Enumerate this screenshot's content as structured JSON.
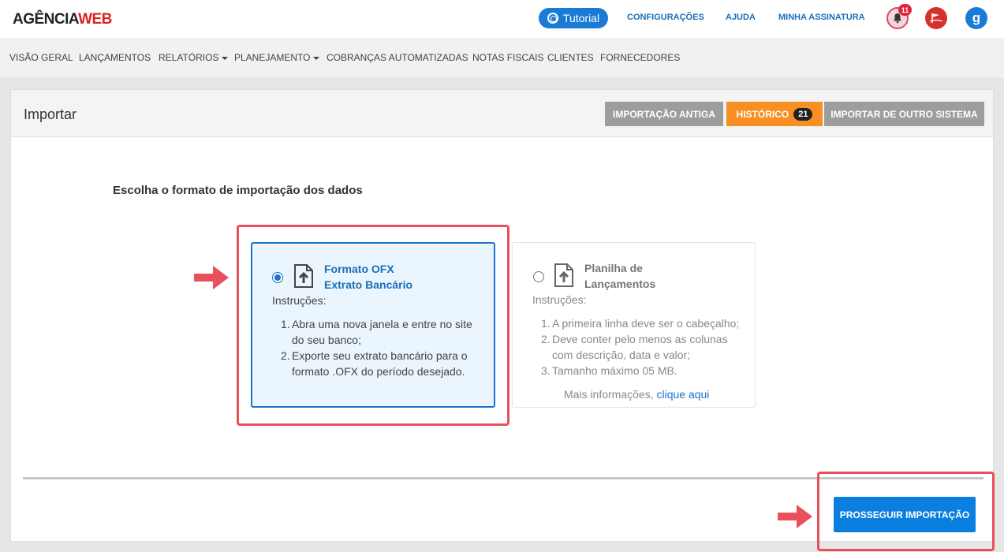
{
  "header": {
    "logo_part1": "AGÊNCIA",
    "logo_part2": "WEB",
    "tutorial_label": "Tutorial",
    "links": [
      "CONFIGURAÇÕES",
      "AJUDA",
      "MINHA ASSINATURA"
    ],
    "notification_count": "11",
    "user_initial": "g",
    "icons": {
      "tutorial": "lifebuoy-icon",
      "notifications": "bell-icon",
      "company": "flag-icon"
    }
  },
  "nav": {
    "items": [
      "VISÃO GERAL",
      "LANÇAMENTOS",
      "RELATÓRIOS",
      "PLANEJAMENTO",
      "COBRANÇAS AUTOMATIZADAS",
      "NOTAS FISCAIS",
      "CLIENTES",
      "FORNECEDORES"
    ],
    "dropdown_items": [
      "RELATÓRIOS",
      "PLANEJAMENTO"
    ]
  },
  "panel": {
    "title": "Importar",
    "buttons": {
      "old_import": "IMPORTAÇÃO ANTIGA",
      "history": "HISTÓRICO",
      "history_count": "21",
      "other_system": "IMPORTAR DE OUTRO SISTEMA"
    },
    "heading": "Escolha o formato de importação dos dados",
    "options": [
      {
        "title_line1": "Formato OFX",
        "title_line2": "Extrato Bancário",
        "selected": true,
        "instructions_label": "Instruções:",
        "steps": [
          {
            "n": "1.",
            "lines": [
              "Abra uma nova janela e entre no site",
              "do seu banco;"
            ]
          },
          {
            "n": "2.",
            "lines": [
              "Exporte seu extrato bancário para o",
              "formato .OFX do período desejado."
            ]
          }
        ]
      },
      {
        "title_line1": "Planilha de",
        "title_line2": "Lançamentos",
        "selected": false,
        "instructions_label": "Instruções:",
        "steps": [
          {
            "n": "1.",
            "lines": [
              "A primeira linha deve ser o cabeçalho;"
            ]
          },
          {
            "n": "2.",
            "lines": [
              "Deve conter pelo menos as colunas",
              "com descrição, data e valor;"
            ]
          },
          {
            "n": "3.",
            "lines": [
              "Tamanho máximo 05 MB."
            ]
          }
        ],
        "more_info_prefix": "Mais informações,",
        "more_info_link": "clique aqui"
      }
    ],
    "proceed_label": "PROSSEGUIR IMPORTAÇÃO"
  },
  "colors": {
    "accent_blue": "#1a73c9",
    "history_orange": "#f78f22",
    "highlight_red": "#e8505b",
    "proceed_blue": "#0b7fe0"
  }
}
